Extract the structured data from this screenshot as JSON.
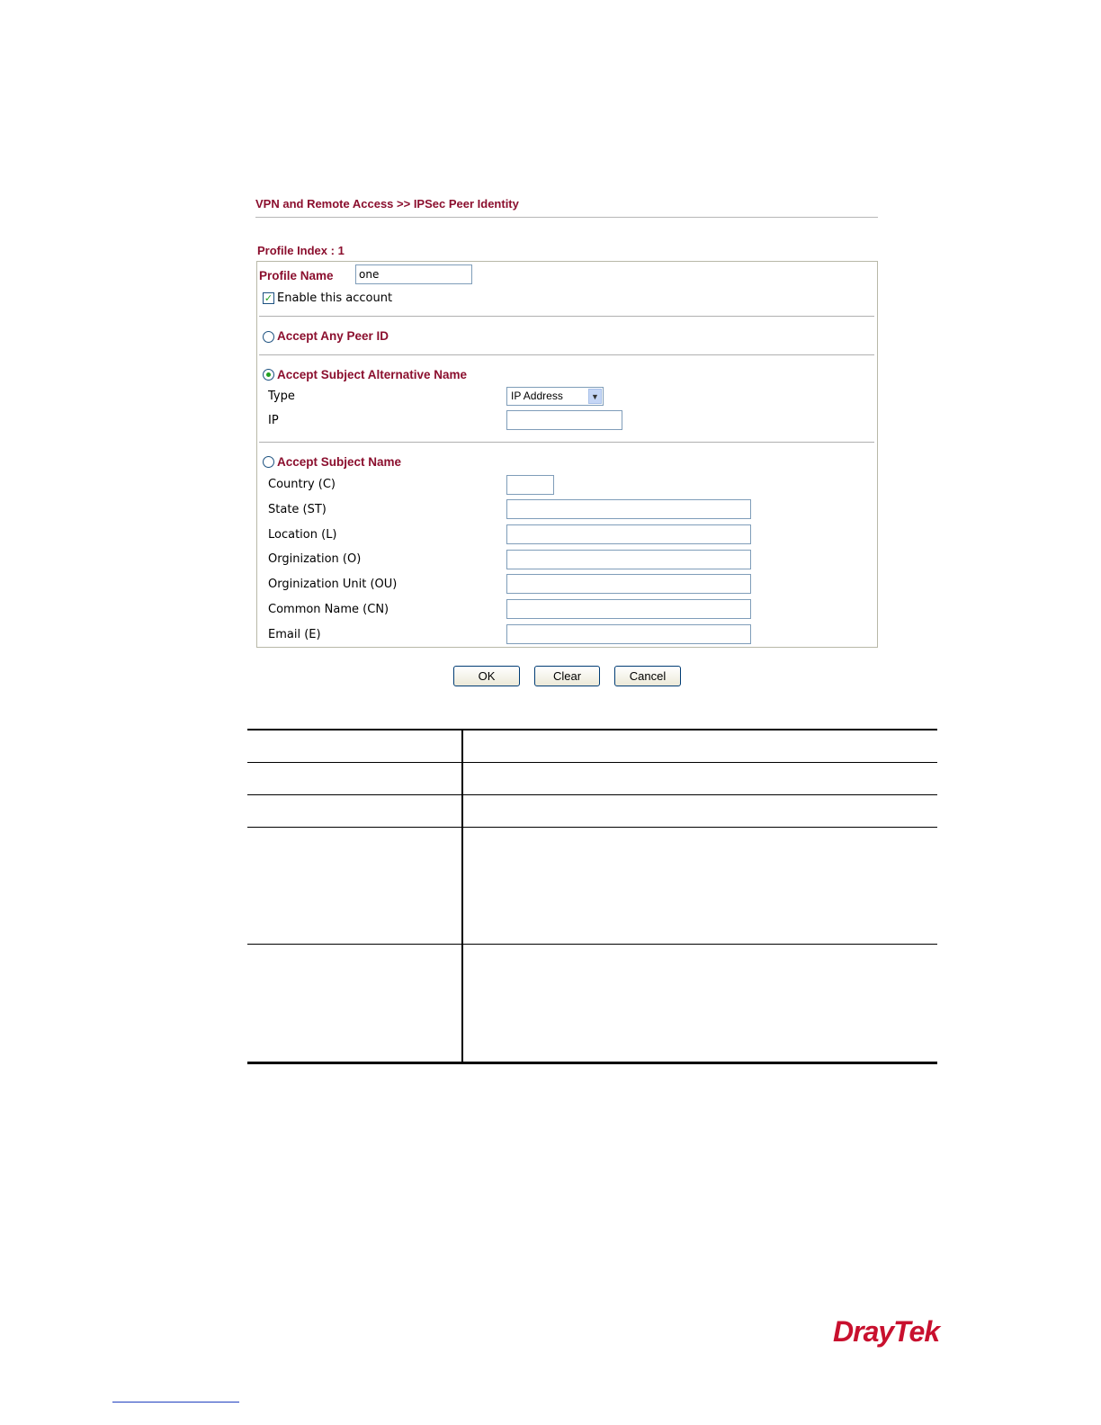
{
  "header": {
    "title": "VPN and Remote Access >> IPSec Peer Identity",
    "profile_index": "Profile Index : 1"
  },
  "profile": {
    "name_label": "Profile Name",
    "name_value": "one",
    "enable_label": "Enable this account",
    "enable_checked": true
  },
  "accept_any": {
    "label": "Accept Any Peer ID",
    "selected": false
  },
  "accept_alt": {
    "label": "Accept Subject Alternative Name",
    "selected": true,
    "type_label": "Type",
    "type_value": "IP Address",
    "ip_label": "IP",
    "ip_value": ""
  },
  "accept_subject": {
    "label": "Accept Subject Name",
    "selected": false,
    "fields": {
      "country": {
        "label": "Country (C)",
        "value": ""
      },
      "state": {
        "label": "State (ST)",
        "value": ""
      },
      "location": {
        "label": "Location (L)",
        "value": ""
      },
      "org": {
        "label": "Orginization (O)",
        "value": ""
      },
      "org_unit": {
        "label": "Orginization Unit (OU)",
        "value": ""
      },
      "common_name": {
        "label": "Common Name (CN)",
        "value": ""
      },
      "email": {
        "label": "Email (E)",
        "value": ""
      }
    }
  },
  "buttons": {
    "ok": "OK",
    "clear": "Clear",
    "cancel": "Cancel"
  },
  "brand": {
    "logo_text": "DrayTek",
    "color": "#c8102e"
  },
  "colors": {
    "label": "#8b0f2e",
    "radio_dot": "#21a121"
  }
}
